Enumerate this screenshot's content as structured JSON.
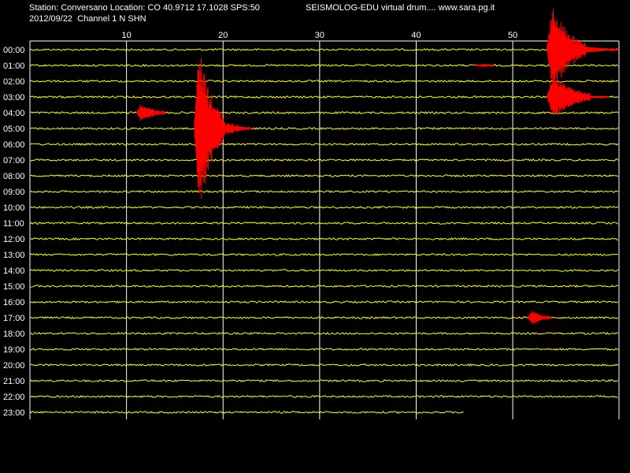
{
  "header": {
    "station_line": "Station: Conversano Location: CO 40.9712 17.1028 SPS:50",
    "date_channel_line": "2012/09/22  Channel 1 N SHN",
    "title": "SEISMOLOG-EDU virtual drum.... www.sara.pg.it"
  },
  "chart_data": {
    "type": "line",
    "title": "SEISMOLOG-EDU virtual drum.... www.sara.pg.it",
    "x_ticks": [
      10,
      20,
      30,
      40,
      50
    ],
    "xlim": [
      0,
      61
    ],
    "y_tick_labels": [
      "00:00",
      "01:00",
      "02:00",
      "03:00",
      "04:00",
      "05:00",
      "06:00",
      "07:00",
      "08:00",
      "09:00",
      "10:00",
      "11:00",
      "12:00",
      "13:00",
      "14:00",
      "15:00",
      "16:00",
      "17:00",
      "18:00",
      "19:00",
      "20:00",
      "21:00",
      "22:00",
      "23:00"
    ],
    "last_trace_end_minute": 45,
    "grid": true,
    "colors": {
      "trace": "#ffff00",
      "event": "#ff0000",
      "grid": "#ffffff",
      "background": "#000000"
    },
    "events": [
      {
        "trace": "00:00",
        "start_min": 53.5,
        "end_min": 57.5,
        "amplitude": 58,
        "taper_end_min": 61
      },
      {
        "trace": "01:00",
        "start_min": 46,
        "end_min": 48,
        "amplitude": 1.5
      },
      {
        "trace": "03:00",
        "start_min": 53.5,
        "end_min": 58,
        "amplitude": 30,
        "taper_end_min": 60
      },
      {
        "trace": "04:00",
        "start_min": 11,
        "end_min": 14,
        "amplitude": 12
      },
      {
        "trace": "05:00",
        "start_min": 17,
        "end_min": 20,
        "amplitude": 112,
        "taper_end_min": 23
      },
      {
        "trace": "17:00",
        "start_min": 51.5,
        "end_min": 54,
        "amplitude": 10
      }
    ]
  }
}
